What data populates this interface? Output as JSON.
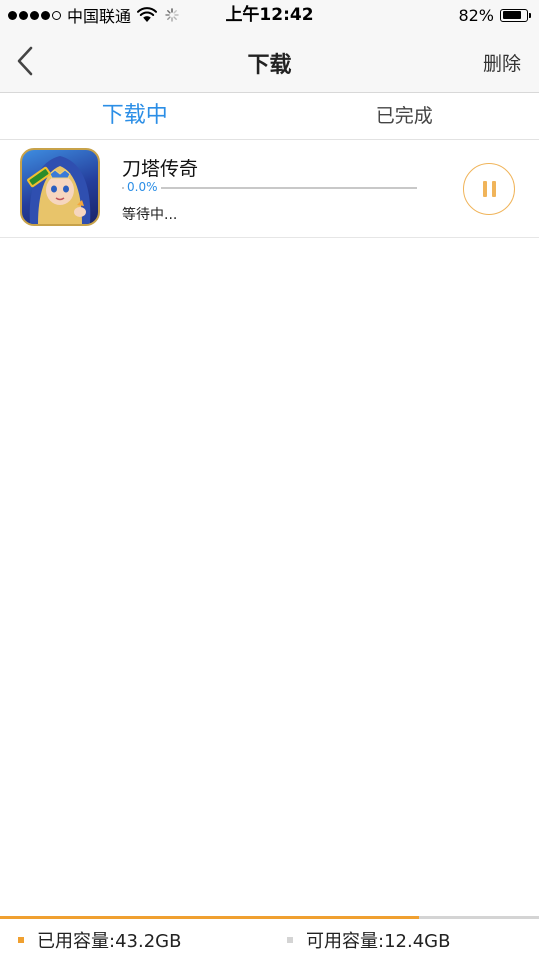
{
  "status_bar": {
    "carrier": "中国联通",
    "time": "上午12:42",
    "battery_percent": "82%",
    "battery_level": 0.82,
    "signal_bars_filled": 4,
    "signal_bars_total": 5,
    "icons": [
      "wifi-icon",
      "activity-spinner-icon",
      "battery-icon"
    ]
  },
  "nav": {
    "back_icon": "chevron-left-icon",
    "title": "下载",
    "delete_label": "删除"
  },
  "tabs": [
    {
      "label": "下载中",
      "active": true
    },
    {
      "label": "已完成",
      "active": false
    }
  ],
  "downloads": [
    {
      "name": "刀塔传奇",
      "progress_label": "0.0%",
      "progress": 0.0,
      "status": "等待中...",
      "action_icon": "pause-icon"
    }
  ],
  "storage": {
    "used_label": "已用容量:43.2GB",
    "free_label": "可用容量:12.4GB",
    "used_fraction": 0.777,
    "used_color": "#f0a030",
    "free_color": "#d4d4d4"
  },
  "colors": {
    "accent_blue": "#2b8ee6",
    "pause_orange": "#f0b45a",
    "nav_background": "#f7f7f7"
  }
}
